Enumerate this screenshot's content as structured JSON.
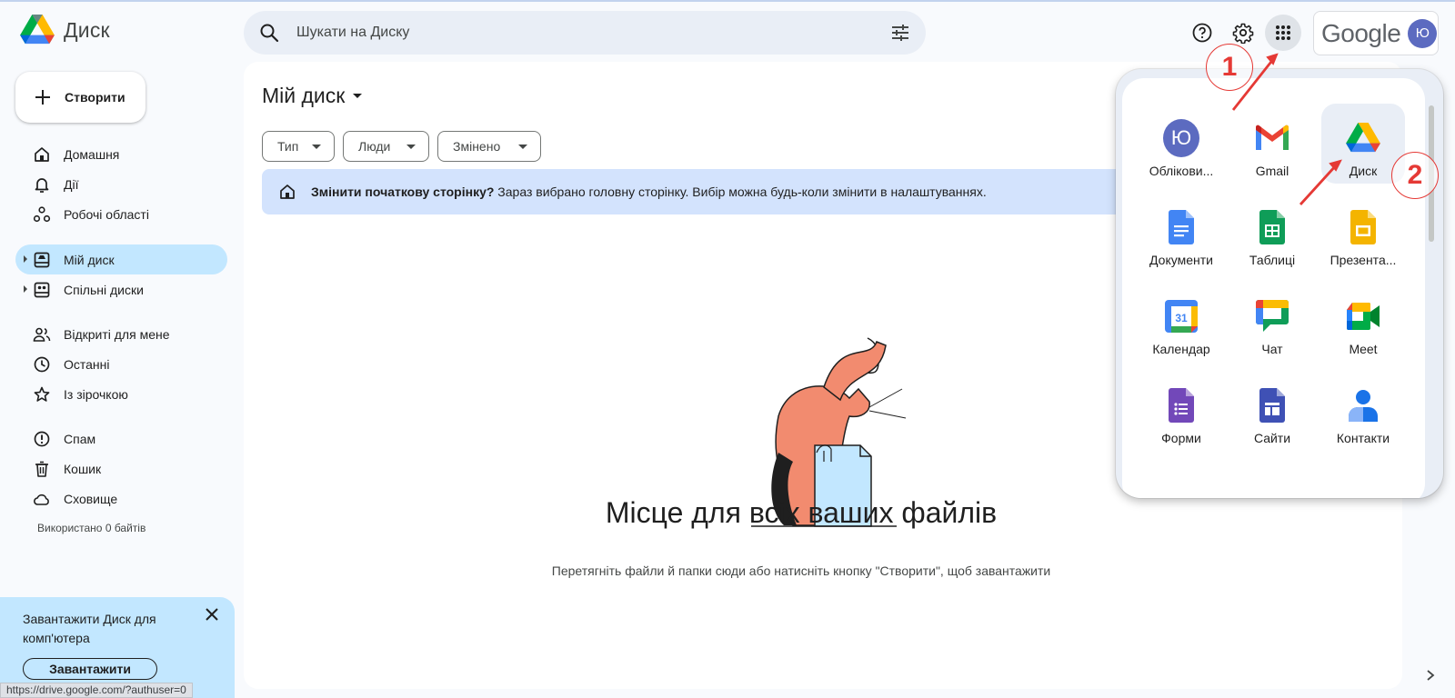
{
  "header": {
    "app_name": "Диск",
    "search_placeholder": "Шукати на Диску",
    "google_word": "Google",
    "avatar_letter": "Ю"
  },
  "sidebar": {
    "create_label": "Створити",
    "items": [
      {
        "label": "Домашня",
        "icon": "home-icon"
      },
      {
        "label": "Дії",
        "icon": "bell-icon"
      },
      {
        "label": "Робочі області",
        "icon": "workspaces-icon"
      },
      {
        "label": "Мій диск",
        "icon": "my-drive-icon",
        "active": true
      },
      {
        "label": "Спільні диски",
        "icon": "shared-drives-icon"
      },
      {
        "label": "Відкриті для мене",
        "icon": "people-icon"
      },
      {
        "label": "Останні",
        "icon": "clock-icon"
      },
      {
        "label": "Із зірочкою",
        "icon": "star-icon"
      },
      {
        "label": "Спам",
        "icon": "spam-icon"
      },
      {
        "label": "Кошик",
        "icon": "trash-icon"
      },
      {
        "label": "Сховище",
        "icon": "cloud-icon"
      }
    ],
    "storage_used": "Використано 0 байтів"
  },
  "promo": {
    "text": "Завантажити Диск для комп'ютера",
    "button": "Завантажити"
  },
  "status_url": "https://drive.google.com/?authuser=0",
  "main": {
    "title": "Мій диск",
    "filters": [
      "Тип",
      "Люди",
      "Змінено"
    ],
    "banner_bold": "Змінити початкову сторінку?",
    "banner_text": " Зараз вибрано головну сторінку. Вибір можна будь-коли змінити в налаштуваннях.",
    "empty_title": "Місце для всіх ваших файлів",
    "empty_subtitle": "Перетягніть файли й папки сюди або натисніть кнопку \"Створити\", щоб завантажити"
  },
  "apps": [
    {
      "label": "Облікови...",
      "icon": "account-icon"
    },
    {
      "label": "Gmail",
      "icon": "gmail-icon"
    },
    {
      "label": "Диск",
      "icon": "drive-icon",
      "highlighted": true
    },
    {
      "label": "Документи",
      "icon": "docs-icon"
    },
    {
      "label": "Таблиці",
      "icon": "sheets-icon"
    },
    {
      "label": "Презента...",
      "icon": "slides-icon"
    },
    {
      "label": "Календар",
      "icon": "calendar-icon"
    },
    {
      "label": "Чат",
      "icon": "chat-icon"
    },
    {
      "label": "Meet",
      "icon": "meet-icon"
    },
    {
      "label": "Форми",
      "icon": "forms-icon"
    },
    {
      "label": "Сайти",
      "icon": "sites-icon"
    },
    {
      "label": "Контакти",
      "icon": "contacts-icon"
    }
  ],
  "calendar_day": "31",
  "annotations": [
    "1",
    "2"
  ],
  "colors": {
    "accent": "#c2e7ff",
    "annotation": "#e53935",
    "avatar": "#5c6bc0"
  }
}
